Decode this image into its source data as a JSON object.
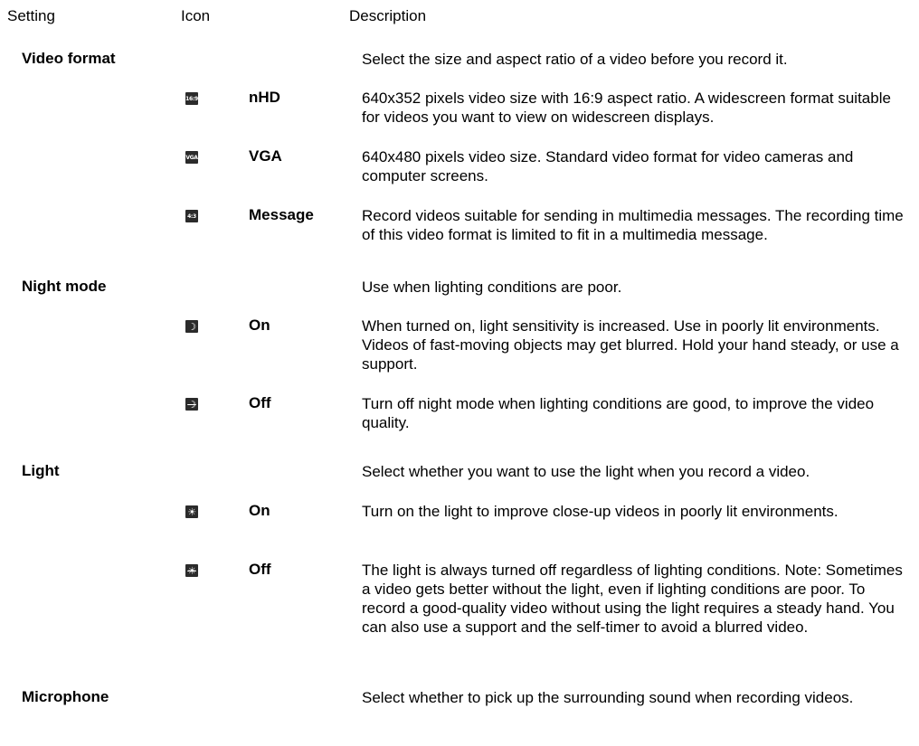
{
  "header": {
    "setting": "Setting",
    "icon": "Icon",
    "description": "Description"
  },
  "settings": [
    {
      "label": "Video format",
      "description": "Select the size and aspect ratio of a video before you record it.",
      "options": [
        {
          "icon": "video-format-16-9-icon",
          "icon_text": "16:9",
          "label": "nHD",
          "description": "640x352 pixels video size with 16:9 aspect ratio. A widescreen format suitable for videos you want to view on widescreen displays."
        },
        {
          "icon": "video-format-vga-icon",
          "icon_text": "VGA",
          "label": "VGA",
          "description": "640x480 pixels video size. Standard video format for video cameras and computer screens."
        },
        {
          "icon": "video-format-message-icon",
          "icon_text": "4:3",
          "label": "Message",
          "description": "Record videos suitable for sending in multimedia messages. The recording time of this video format is limited to fit in a multimedia message."
        }
      ]
    },
    {
      "label": "Night mode",
      "description": "Use when lighting conditions are poor.",
      "options": [
        {
          "icon": "night-mode-on-icon",
          "icon_text": "☽",
          "label": "On",
          "description": "When turned on, light sensitivity is increased. Use in poorly lit environments. Videos of fast-moving objects may get blurred. Hold your hand steady, or use a support."
        },
        {
          "icon": "night-mode-off-icon",
          "icon_text": "☽",
          "label": "Off",
          "description": "Turn off night mode when lighting conditions are good, to improve the video quality."
        }
      ]
    },
    {
      "label": "Light",
      "description": "Select whether you want to use the light when you record a video.",
      "options": [
        {
          "icon": "light-on-icon",
          "icon_text": "☀",
          "label": "On",
          "description": "Turn on the light to improve close-up videos in poorly lit environments."
        },
        {
          "icon": "light-off-icon",
          "icon_text": "☀",
          "label": "Off",
          "description": "The light is always turned off regardless of lighting conditions. Note: Sometimes a video gets better without the light, even if lighting conditions are poor. To record a good-quality video without using the light requires a steady hand. You can also use a support and the self-timer to avoid a blurred video."
        }
      ]
    },
    {
      "label": "Microphone",
      "description": "Select whether to pick up the surrounding sound when recording videos.",
      "options": []
    }
  ]
}
